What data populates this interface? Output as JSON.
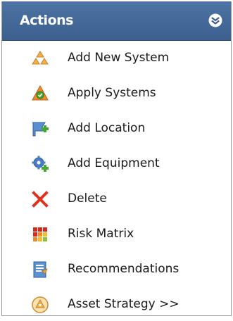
{
  "panel": {
    "title": "Actions",
    "collapse_icon": "double-chevron-up-icon"
  },
  "items": [
    {
      "label": "Add New System",
      "icon": "add-new-system-icon"
    },
    {
      "label": "Apply Systems",
      "icon": "apply-systems-icon"
    },
    {
      "label": "Add Location",
      "icon": "add-location-icon"
    },
    {
      "label": "Add Equipment",
      "icon": "add-equipment-icon"
    },
    {
      "label": "Delete",
      "icon": "delete-icon"
    },
    {
      "label": "Risk Matrix",
      "icon": "risk-matrix-icon"
    },
    {
      "label": "Recommendations",
      "icon": "recommendations-icon"
    },
    {
      "label": "Asset Strategy >>",
      "icon": "asset-strategy-icon"
    }
  ],
  "colors": {
    "header_top": "#4d74a4",
    "header_bottom": "#3c5f8e",
    "delete_red": "#e0301e",
    "orange": "#f0a030",
    "green": "#46a832",
    "blue": "#4a7cc0"
  }
}
